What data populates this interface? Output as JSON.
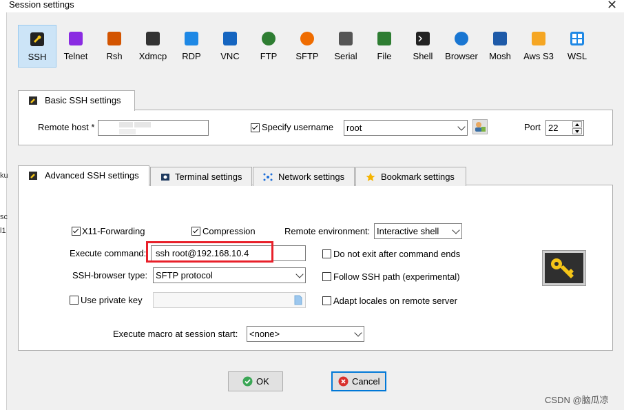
{
  "window": {
    "title": "Session settings",
    "close_glyph": "✕"
  },
  "left_strip": [
    "ku",
    "sc",
    "l1"
  ],
  "protocols": [
    {
      "label": "SSH",
      "icon": "ssh-wrench-icon",
      "color": "#222"
    },
    {
      "label": "Telnet",
      "icon": "telnet-icon",
      "color": "#8a2be2"
    },
    {
      "label": "Rsh",
      "icon": "rsh-icon",
      "color": "#d35400"
    },
    {
      "label": "Xdmcp",
      "icon": "xdmcp-icon",
      "color": "#333"
    },
    {
      "label": "RDP",
      "icon": "rdp-icon",
      "color": "#1e88e5"
    },
    {
      "label": "VNC",
      "icon": "vnc-icon",
      "color": "#1565c0"
    },
    {
      "label": "FTP",
      "icon": "ftp-icon",
      "color": "#2e7d32"
    },
    {
      "label": "SFTP",
      "icon": "sftp-icon",
      "color": "#ef6c00"
    },
    {
      "label": "Serial",
      "icon": "serial-icon",
      "color": "#555"
    },
    {
      "label": "File",
      "icon": "file-icon",
      "color": "#2e7d32"
    },
    {
      "label": "Shell",
      "icon": "shell-icon",
      "color": "#222"
    },
    {
      "label": "Browser",
      "icon": "browser-globe-icon",
      "color": "#1976d2"
    },
    {
      "label": "Mosh",
      "icon": "mosh-antenna-icon",
      "color": "#1e5aa8"
    },
    {
      "label": "Aws S3",
      "icon": "aws-s3-icon",
      "color": "#f5a623"
    },
    {
      "label": "WSL",
      "icon": "wsl-windows-icon",
      "color": "#1e88e5"
    }
  ],
  "basic": {
    "tab_label": "Basic SSH settings",
    "remote_host_label": "Remote host *",
    "remote_host_value": "",
    "specify_username_label": "Specify username",
    "specify_username_checked": true,
    "username_value": "root",
    "port_label": "Port",
    "port_value": "22"
  },
  "tabs": [
    {
      "label": "Advanced SSH settings",
      "icon": "wrench-icon",
      "active": true
    },
    {
      "label": "Terminal settings",
      "icon": "terminal-icon",
      "active": false
    },
    {
      "label": "Network settings",
      "icon": "network-icon",
      "active": false
    },
    {
      "label": "Bookmark settings",
      "icon": "star-icon",
      "active": false
    }
  ],
  "advanced": {
    "x11_label": "X11-Forwarding",
    "x11_checked": true,
    "compression_label": "Compression",
    "compression_checked": true,
    "remote_env_label": "Remote environment:",
    "remote_env_value": "Interactive shell",
    "execute_command_label": "Execute command:",
    "execute_command_value": "ssh root@192.168.10.4",
    "do_not_exit_label": "Do not exit after command ends",
    "do_not_exit_checked": false,
    "ssh_browser_label": "SSH-browser type:",
    "ssh_browser_value": "SFTP protocol",
    "follow_ssh_label": "Follow SSH path (experimental)",
    "follow_ssh_checked": false,
    "private_key_label": "Use private key",
    "private_key_checked": false,
    "adapt_locales_label": "Adapt locales on remote server",
    "adapt_locales_checked": false,
    "macro_label": "Execute macro at session start:",
    "macro_value": "<none>"
  },
  "buttons": {
    "ok": "OK",
    "cancel": "Cancel"
  },
  "watermark": "CSDN @脑瓜凉",
  "colors": {
    "highlight_box": "#e8202a",
    "selected_bg": "#cce4f7",
    "default_button_border": "#0078d7"
  }
}
